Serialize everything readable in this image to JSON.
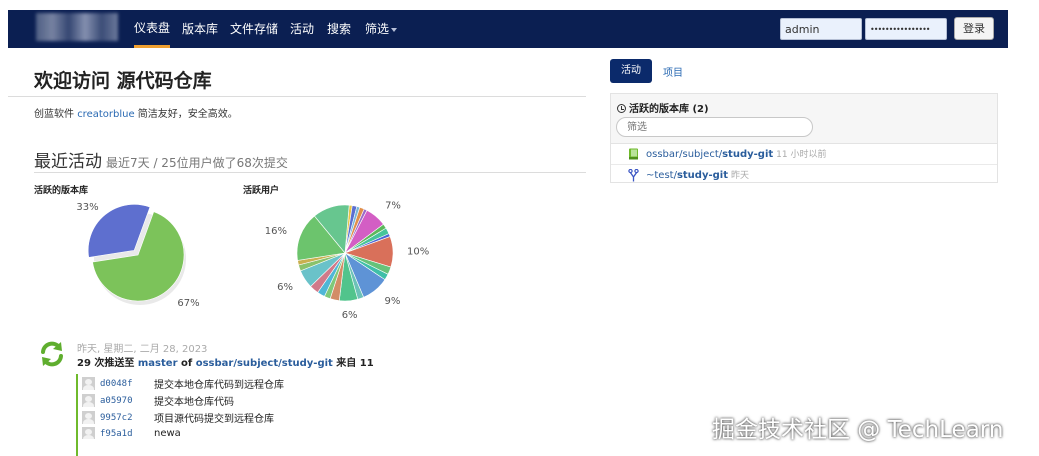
{
  "navbar": {
    "items": [
      {
        "label": "仪表盘",
        "active": true
      },
      {
        "label": "版本库",
        "active": false
      },
      {
        "label": "文件存储",
        "active": false
      },
      {
        "label": "活动",
        "active": false
      },
      {
        "label": "搜索",
        "active": false
      },
      {
        "label": "筛选",
        "active": false,
        "dropdown": true
      }
    ],
    "username_value": "admin",
    "password_mask": "••••••••••••••••",
    "login_label": "登录",
    "colors": {
      "bar": "#0b1f52",
      "active_underline": "#f0a030"
    }
  },
  "main": {
    "title": "欢迎访问 源代码仓库",
    "subtitle_prefix": "创蓝软件 ",
    "subtitle_link": "creatorblue",
    "subtitle_suffix": " 简洁友好，安全高效。",
    "recent_title": "最近活动",
    "recent_summary": "最近7天 / 25位用户做了68次提交"
  },
  "chart_data": [
    {
      "type": "pie",
      "title": "活跃的版本库",
      "slices": [
        {
          "value": 67,
          "label": "67%",
          "color": "#7cc35a"
        },
        {
          "value": 33,
          "label": "33%",
          "color": "#5e6fcf"
        }
      ]
    },
    {
      "type": "pie",
      "title": "活跃用户",
      "slices": [
        {
          "value": 1,
          "color": "#e8c547"
        },
        {
          "value": 1.5,
          "color": "#5b6ed0"
        },
        {
          "value": 1,
          "color": "#77b6d9"
        },
        {
          "value": 1.5,
          "color": "#e08f4b"
        },
        {
          "value": 1,
          "color": "#9a6ac8"
        },
        {
          "value": 7,
          "label": "7%",
          "color": "#d35ec4"
        },
        {
          "value": 1.5,
          "color": "#5cb85c"
        },
        {
          "value": 2,
          "color": "#45c49a"
        },
        {
          "value": 1,
          "color": "#4b66d6"
        },
        {
          "value": 10,
          "label": "10%",
          "color": "#d9705a"
        },
        {
          "value": 2.5,
          "color": "#66c27a"
        },
        {
          "value": 2,
          "color": "#3fbfa8"
        },
        {
          "value": 9,
          "label": "9%",
          "color": "#5e93d6"
        },
        {
          "value": 2,
          "color": "#6cc2b8"
        },
        {
          "value": 6,
          "label": "6%",
          "color": "#51c48c"
        },
        {
          "value": 3,
          "color": "#d38d66"
        },
        {
          "value": 2,
          "color": "#7fc979"
        },
        {
          "value": 2.5,
          "color": "#4fb7d6"
        },
        {
          "value": 3,
          "color": "#d17a8a"
        },
        {
          "value": 6,
          "label": "6%",
          "color": "#6ac2c9"
        },
        {
          "value": 2,
          "color": "#8ac26b"
        },
        {
          "value": 1.5,
          "color": "#c9b04f"
        },
        {
          "value": 16,
          "label": "16%",
          "color": "#6cc46d"
        },
        {
          "value": 12,
          "color": "#67c68f"
        }
      ]
    }
  ],
  "event": {
    "date": "昨天, 星期二, 二月 28, 2023",
    "count_text": "29 次推送至 ",
    "branch": "master",
    "of_text": " of ",
    "repo": "ossbar/subject/study-git",
    "from_text": " 来自 11",
    "commits": [
      {
        "sha": "d0048f",
        "message": "提交本地仓库代码到远程仓库"
      },
      {
        "sha": "a05970",
        "message": "提交本地仓库代码"
      },
      {
        "sha": "9957c2",
        "message": "项目源代码提交到远程仓库"
      },
      {
        "sha": "f95a1d",
        "message": "newa"
      }
    ]
  },
  "sidebar": {
    "tab_activity": "活动",
    "tab_projects": "项目",
    "panel_title": "活跃的版本库 (2)",
    "filter_placeholder": "筛选",
    "repos": [
      {
        "prefix": "ossbar/subject/",
        "name": "study-git",
        "time": "11 小时以前",
        "icon": "repo-book-icon"
      },
      {
        "prefix": "~test/",
        "name": "study-git",
        "time": "昨天",
        "icon": "fork-icon"
      }
    ]
  },
  "watermark": "掘金技术社区 @ TechLearn"
}
